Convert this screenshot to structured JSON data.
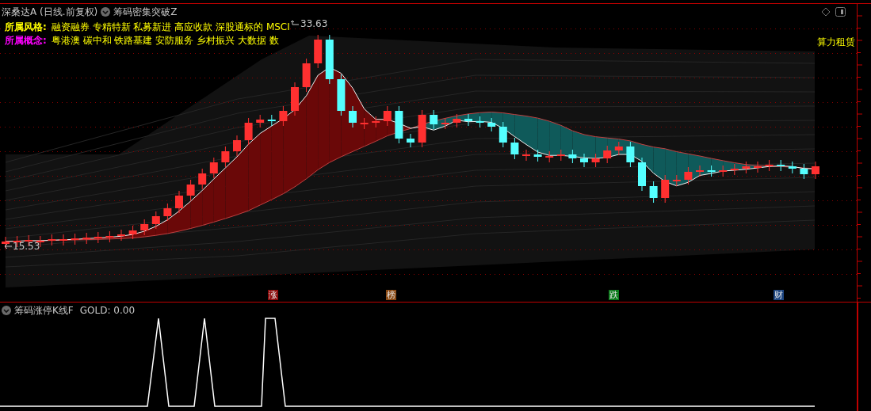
{
  "header": {
    "title": "深桑达A (日线.前复权)",
    "indicator": "筹码密集突破Z"
  },
  "info_lines": [
    {
      "label": "所属风格:",
      "color": "#ffff00",
      "text": "融资融券 专精特新 私募新进 高应收款 深股通标的 MSCI"
    },
    {
      "label": "所属概念:",
      "color": "#ff00ff",
      "text": "粤港澳 碳中和 铁路基建 安防服务 乡村振兴 大数据 数"
    }
  ],
  "info_overflow": "算力租赁",
  "price_marks": {
    "high": "33.63",
    "low": "15.53"
  },
  "event_tags": [
    {
      "label": "涨",
      "color": "#8b0a0a"
    },
    {
      "label": "榜",
      "color": "#8b4a14"
    },
    {
      "label": "跌",
      "color": "#0a7a1a"
    },
    {
      "label": "财",
      "color": "#1d4580"
    }
  ],
  "sub_panel": {
    "title": "筹码涨停K线F",
    "reading": "GOLD: 0.00"
  }
}
